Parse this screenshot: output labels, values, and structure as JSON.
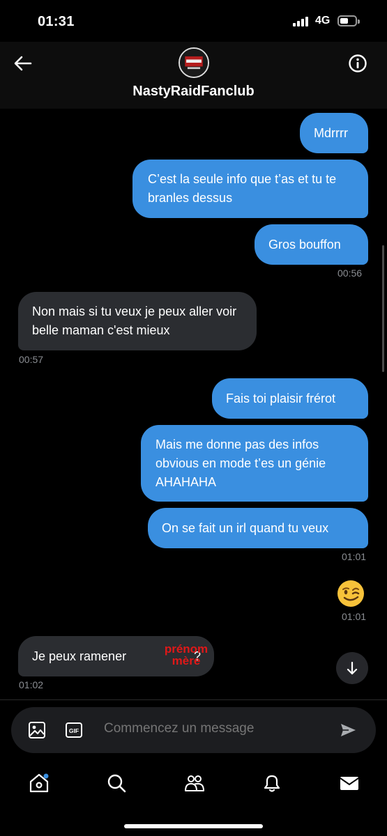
{
  "status_bar": {
    "time": "01:31",
    "network": "4G"
  },
  "header": {
    "conversation_name": "NastyRaidFanclub"
  },
  "messages": [
    {
      "text": "Mdrrrr"
    },
    {
      "text": "C’est la seule info que t’as et tu te branles dessus"
    },
    {
      "text": "Gros bouffon",
      "time": "00:56"
    },
    {
      "text": "Non mais si tu veux je peux aller voir belle maman c'est mieux",
      "time": "00:57"
    },
    {
      "text": "Fais toi plaisir frérot"
    },
    {
      "text": "Mais me donne pas des infos obvious en mode t’es un génie AHAHAHA"
    },
    {
      "text": "On se fait un irl quand tu veux",
      "time": "01:01"
    },
    {
      "emoji": "winking-face",
      "time": "01:01"
    },
    {
      "text_before": "Je peux ramener ",
      "censor_line1": "prénom",
      "censor_line2": "mère",
      "text_after": "?",
      "time": "01:02"
    }
  ],
  "composer": {
    "placeholder": "Commencez un message",
    "gif_label": "GIF"
  },
  "colors": {
    "outgoing": "#3a8fe0",
    "incoming": "#2b2d31",
    "censor": "#e01818"
  }
}
